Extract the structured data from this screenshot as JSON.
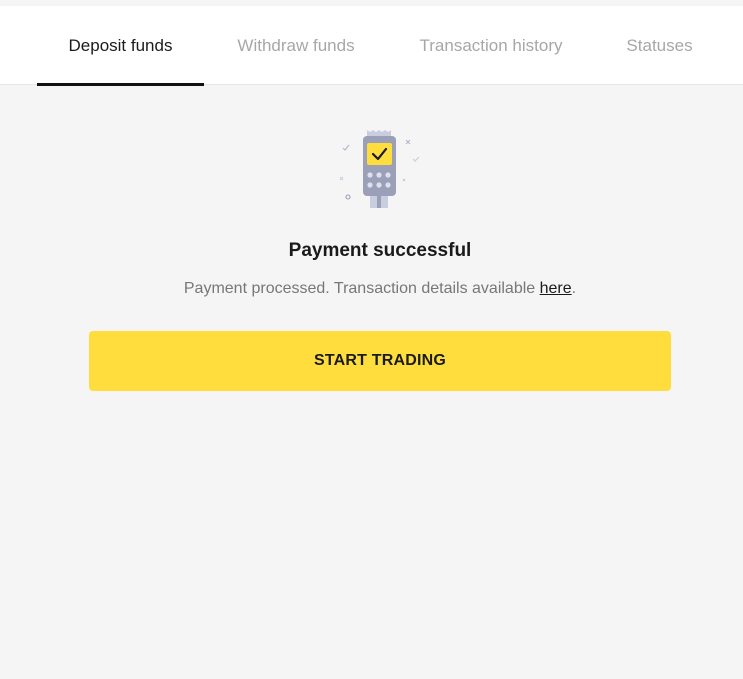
{
  "tabs": [
    {
      "label": "Deposit funds",
      "active": true
    },
    {
      "label": "Withdraw funds",
      "active": false
    },
    {
      "label": "Transaction history",
      "active": false
    },
    {
      "label": "Statuses",
      "active": false
    }
  ],
  "status": {
    "icon": "payment-terminal-icon",
    "title": "Payment successful",
    "message_prefix": "Payment processed. Transaction details available ",
    "link_text": "here",
    "message_suffix": "."
  },
  "cta": {
    "label": "START TRADING"
  },
  "colors": {
    "accent": "#ffdd3d",
    "background": "#f5f5f5",
    "tab_active": "#1b1b1b",
    "tab_inactive": "#a7a7a7",
    "terminal_body": "#9ba0b8"
  }
}
